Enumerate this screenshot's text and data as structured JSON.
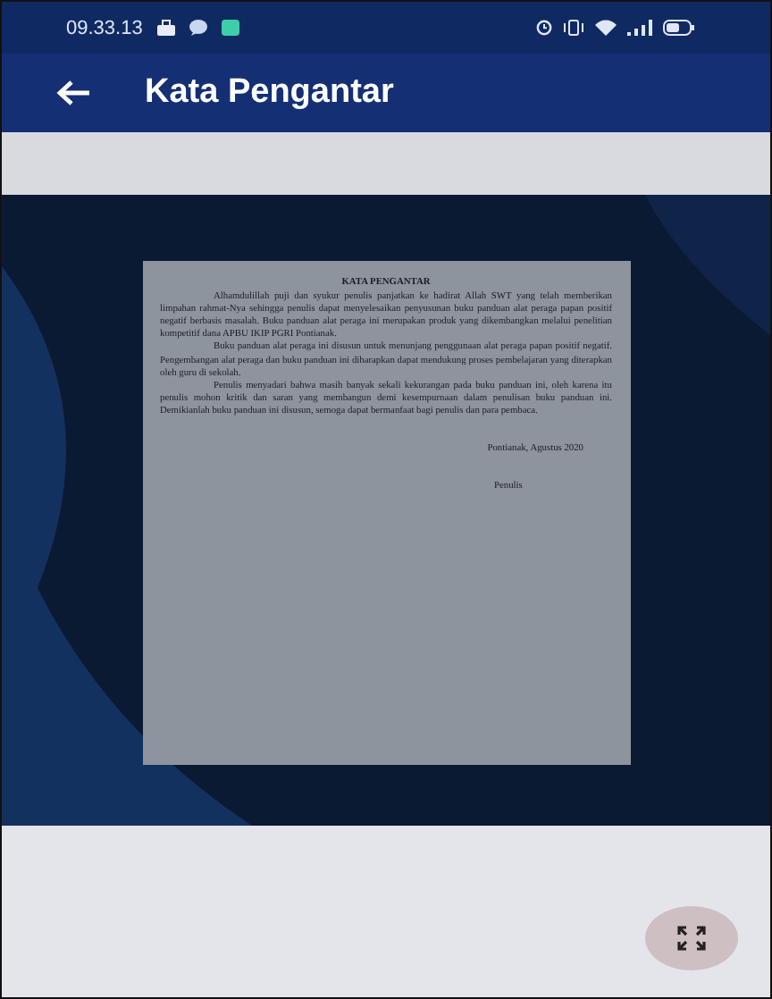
{
  "status_bar": {
    "time": "09.33.13"
  },
  "app_bar": {
    "title": "Kata Pengantar"
  },
  "document": {
    "heading": "KATA PENGANTAR",
    "paragraphs": [
      "Alhamdulillah puji dan syukur penulis panjatkan ke hadirat Allah SWT yang telah memberikan limpahan rahmat-Nya sehingga penulis dapat menyelesaikan penyusunan buku panduan alat peraga papan positif negatif berbasis masalah. Buku panduan alat peraga ini merupakan produk yang dikembangkan melalui penelitian kompetitif dana APBU IKIP PGRI Pontianak.",
      "Buku panduan alat peraga ini disusun untuk menunjang penggunaan alat peraga papan positif negatif. Pengembangan alat peraga dan buku panduan ini diharapkan dapat mendukung proses pembelajaran yang diterapkan oleh guru di sekolah.",
      "Penulis menyadari bahwa masih banyak sekali kekurangan pada buku panduan ini, oleh karena itu penulis mohon kritik dan saran yang membangun demi kesempurnaan dalam penulisan buku panduan ini. Demikianlah buku panduan ini disusun, semoga dapat bermanfaat bagi penulis dan para pembaca."
    ],
    "place_date": "Pontianak,   Agustus 2020",
    "signature": "Penulis"
  }
}
